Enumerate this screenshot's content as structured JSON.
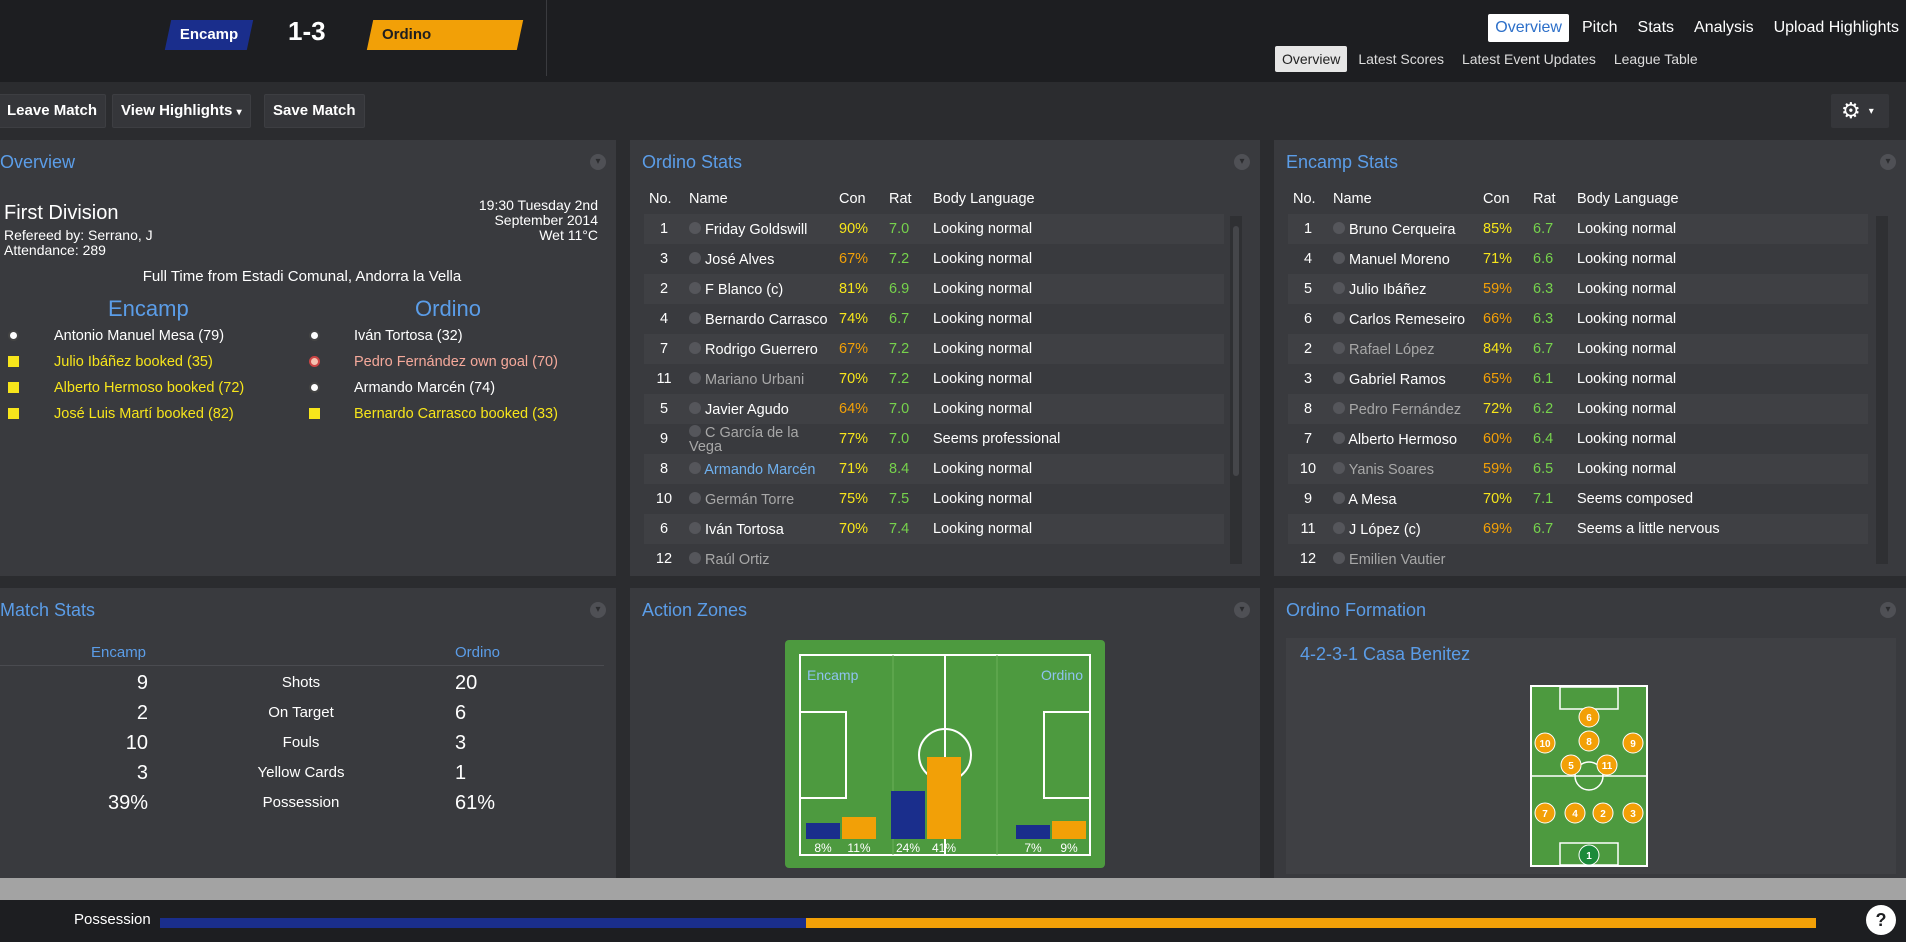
{
  "match": {
    "home": "Encamp",
    "away": "Ordino",
    "score": "1-3",
    "home_color": "#1a2e8c",
    "away_color": "#f2a007"
  },
  "nav": {
    "main": [
      "Overview",
      "Pitch",
      "Stats",
      "Analysis",
      "Upload Highlights"
    ],
    "active_main": "Overview",
    "sub": [
      "Overview",
      "Latest Scores",
      "Latest Event Updates",
      "League Table"
    ],
    "active_sub": "Overview"
  },
  "toolbar": {
    "leave": "Leave Match",
    "highlights": "View Highlights",
    "highlights_caret": "▾",
    "save": "Save Match",
    "settings_icon": "gear-icon",
    "settings_caret": "▾"
  },
  "overview": {
    "title": "Overview",
    "competition": "First Division",
    "referee": "Refereed by: Serrano, J",
    "attendance": "Attendance: 289",
    "date_line1": "19:30 Tuesday 2nd",
    "date_line2": "September 2014",
    "weather": "Wet 11°C",
    "venue": "Full Time from Estadi Comunal, Andorra la Vella",
    "home_events": [
      {
        "icon": "goal",
        "text": "Antonio Manuel Mesa (79)",
        "color": "#ffffff"
      },
      {
        "icon": "yellow",
        "text": "Julio Ibáñez booked (35)",
        "color": "#f7e51b"
      },
      {
        "icon": "yellow",
        "text": "Alberto Hermoso booked (72)",
        "color": "#f7e51b"
      },
      {
        "icon": "yellow",
        "text": "José Luis Martí booked (82)",
        "color": "#f7e51b"
      }
    ],
    "away_events": [
      {
        "icon": "goal",
        "text": "Iván Tortosa (32)",
        "color": "#ffffff"
      },
      {
        "icon": "own-goal",
        "text": "Pedro Fernández own goal (70)",
        "color": "#f5a99b"
      },
      {
        "icon": "goal",
        "text": "Armando Marcén (74)",
        "color": "#ffffff"
      },
      {
        "icon": "yellow",
        "text": "Bernardo Carrasco booked (33)",
        "color": "#f7e51b"
      }
    ]
  },
  "ordino_stats": {
    "title": "Ordino Stats",
    "headers": [
      "No.",
      "Name",
      "Con",
      "Rat",
      "Body Language"
    ],
    "rows": [
      {
        "no": "1",
        "name": "Friday Goldswill",
        "con": "90%",
        "rat": "7.0",
        "body": "Looking normal",
        "name_color": "#ffffff"
      },
      {
        "no": "3",
        "name": "José Alves",
        "con": "67%",
        "rat": "7.2",
        "body": "Looking normal",
        "name_color": "#ffffff"
      },
      {
        "no": "2",
        "name": "F Blanco (c)",
        "con": "81%",
        "rat": "6.9",
        "body": "Looking normal",
        "name_color": "#ffffff"
      },
      {
        "no": "4",
        "name": "Bernardo Carrasco",
        "con": "74%",
        "rat": "6.7",
        "body": "Looking normal",
        "name_color": "#ffffff"
      },
      {
        "no": "7",
        "name": "Rodrigo Guerrero",
        "con": "67%",
        "rat": "7.2",
        "body": "Looking normal",
        "name_color": "#ffffff"
      },
      {
        "no": "11",
        "name": "Mariano Urbani",
        "con": "70%",
        "rat": "7.2",
        "body": "Looking normal",
        "name_color": "#a8a8a8"
      },
      {
        "no": "5",
        "name": "Javier Agudo",
        "con": "64%",
        "rat": "7.0",
        "body": "Looking normal",
        "name_color": "#ffffff"
      },
      {
        "no": "9",
        "name": "C García de la Vega",
        "con": "77%",
        "rat": "7.0",
        "body": "Seems professional",
        "name_color": "#a8a8a8"
      },
      {
        "no": "8",
        "name": "Armando Marcén",
        "con": "71%",
        "rat": "8.4",
        "body": "Looking normal",
        "name_color": "#6fb0ee"
      },
      {
        "no": "10",
        "name": "Germán Torre",
        "con": "75%",
        "rat": "7.5",
        "body": "Looking normal",
        "name_color": "#a8a8a8"
      },
      {
        "no": "6",
        "name": "Iván Tortosa",
        "con": "70%",
        "rat": "7.4",
        "body": "Looking normal",
        "name_color": "#ffffff"
      },
      {
        "no": "12",
        "name": "Raúl Ortiz",
        "con": "",
        "rat": "",
        "body": "",
        "name_color": "#a8a8a8"
      }
    ]
  },
  "encamp_stats": {
    "title": "Encamp Stats",
    "headers": [
      "No.",
      "Name",
      "Con",
      "Rat",
      "Body Language"
    ],
    "rows": [
      {
        "no": "1",
        "name": "Bruno Cerqueira",
        "con": "85%",
        "rat": "6.7",
        "body": "Looking normal",
        "name_color": "#ffffff"
      },
      {
        "no": "4",
        "name": "Manuel Moreno",
        "con": "71%",
        "rat": "6.6",
        "body": "Looking normal",
        "name_color": "#ffffff"
      },
      {
        "no": "5",
        "name": "Julio Ibáñez",
        "con": "59%",
        "rat": "6.3",
        "body": "Looking normal",
        "name_color": "#ffffff"
      },
      {
        "no": "6",
        "name": "Carlos Remeseiro",
        "con": "66%",
        "rat": "6.3",
        "body": "Looking normal",
        "name_color": "#ffffff"
      },
      {
        "no": "2",
        "name": "Rafael López",
        "con": "84%",
        "rat": "6.7",
        "body": "Looking normal",
        "name_color": "#a8a8a8"
      },
      {
        "no": "3",
        "name": "Gabriel Ramos",
        "con": "65%",
        "rat": "6.1",
        "body": "Looking normal",
        "name_color": "#ffffff"
      },
      {
        "no": "8",
        "name": "Pedro Fernández",
        "con": "72%",
        "rat": "6.2",
        "body": "Looking normal",
        "name_color": "#a8a8a8"
      },
      {
        "no": "7",
        "name": "Alberto Hermoso",
        "con": "60%",
        "rat": "6.4",
        "body": "Looking normal",
        "name_color": "#ffffff"
      },
      {
        "no": "10",
        "name": "Yanis Soares",
        "con": "59%",
        "rat": "6.5",
        "body": "Looking normal",
        "name_color": "#a8a8a8"
      },
      {
        "no": "9",
        "name": "A Mesa",
        "con": "70%",
        "rat": "7.1",
        "body": "Seems composed",
        "name_color": "#ffffff"
      },
      {
        "no": "11",
        "name": "J López (c)",
        "con": "69%",
        "rat": "6.7",
        "body": "Seems a little nervous",
        "name_color": "#ffffff"
      },
      {
        "no": "12",
        "name": "Emilien Vautier",
        "con": "",
        "rat": "",
        "body": "",
        "name_color": "#a8a8a8"
      }
    ]
  },
  "match_stats": {
    "title": "Match Stats",
    "home": "Encamp",
    "away": "Ordino",
    "rows": [
      {
        "label": "Shots",
        "home": "9",
        "away": "20"
      },
      {
        "label": "On Target",
        "home": "2",
        "away": "6"
      },
      {
        "label": "Fouls",
        "home": "10",
        "away": "3"
      },
      {
        "label": "Yellow Cards",
        "home": "3",
        "away": "1"
      },
      {
        "label": "Possession",
        "home": "39%",
        "away": "61%"
      }
    ]
  },
  "action_zones": {
    "title": "Action Zones",
    "home_label": "Encamp",
    "away_label": "Ordino",
    "zones": [
      {
        "home": 8,
        "away": 11,
        "home_label": "8%",
        "away_label": "11%"
      },
      {
        "home": 24,
        "away": 41,
        "home_label": "24%",
        "away_label": "41%"
      },
      {
        "home": 7,
        "away": 9,
        "home_label": "7%",
        "away_label": "9%"
      }
    ]
  },
  "formation": {
    "title": "Ordino Formation",
    "name": "4-2-3-1 Casa Benitez",
    "players": [
      "6",
      "10",
      "8",
      "9",
      "5",
      "11",
      "7",
      "4",
      "2",
      "3",
      "1"
    ]
  },
  "bottom": {
    "possession_label": "Possession",
    "home_pct": 39,
    "away_pct": 61,
    "help_icon": "?"
  }
}
